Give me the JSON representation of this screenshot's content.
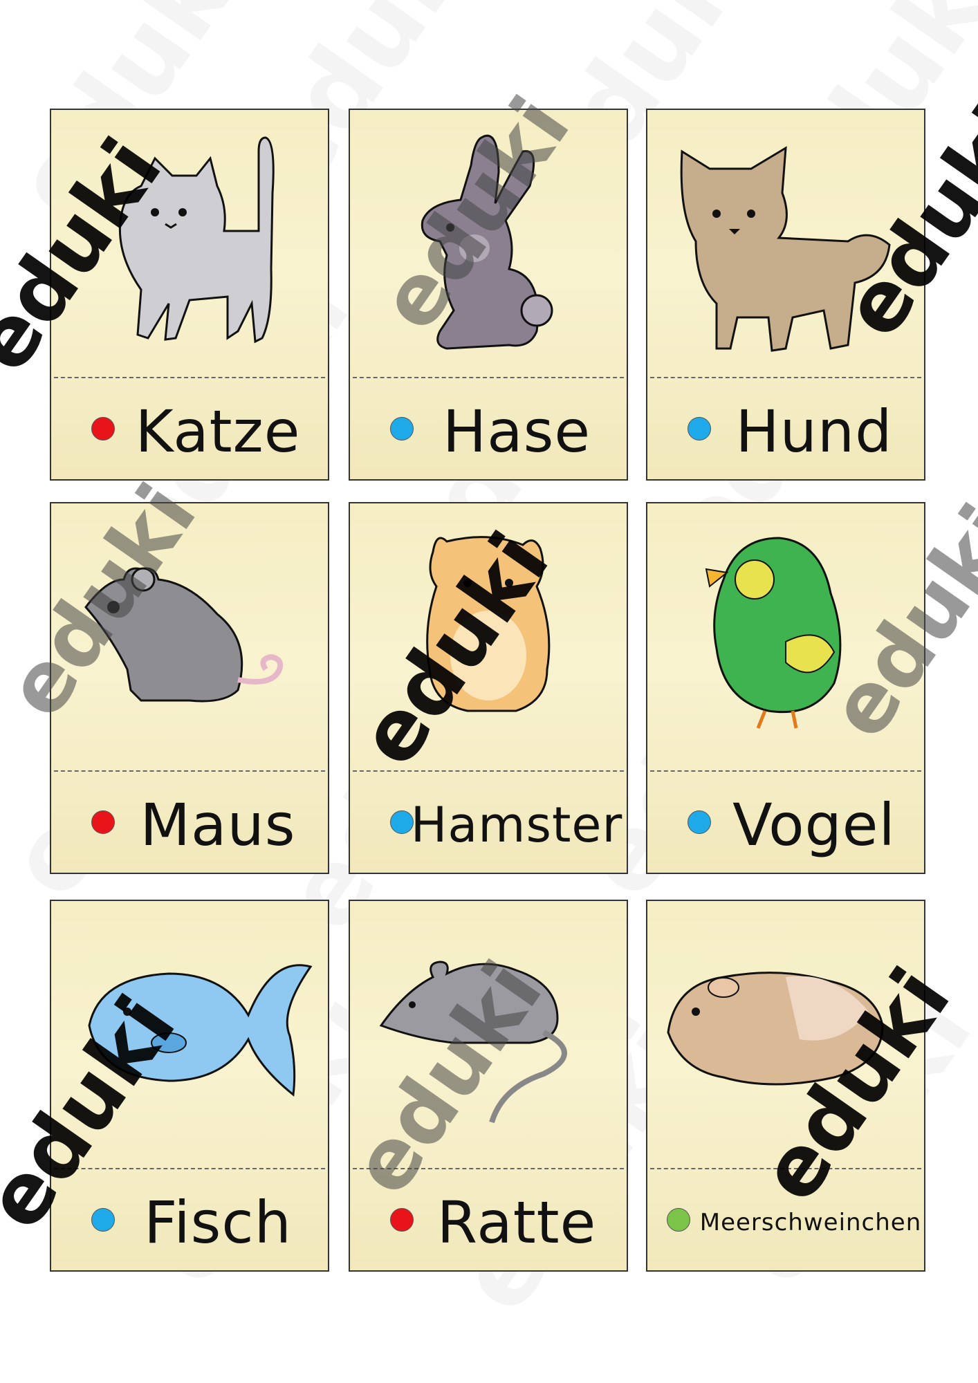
{
  "watermark": "eduki",
  "colors": {
    "red": "#e8141a",
    "blue": "#1ea9e8",
    "green": "#7cc34a"
  },
  "cards": [
    {
      "word": "Katze",
      "dot": "red",
      "icon": "cat-icon"
    },
    {
      "word": "Hase",
      "dot": "blue",
      "icon": "rabbit-icon"
    },
    {
      "word": "Hund",
      "dot": "blue",
      "icon": "dog-icon"
    },
    {
      "word": "Maus",
      "dot": "red",
      "icon": "mouse-icon"
    },
    {
      "word": "Hamster",
      "dot": "blue",
      "icon": "hamster-icon"
    },
    {
      "word": "Vogel",
      "dot": "blue",
      "icon": "bird-icon"
    },
    {
      "word": "Fisch",
      "dot": "blue",
      "icon": "fish-icon"
    },
    {
      "word": "Ratte",
      "dot": "red",
      "icon": "rat-icon"
    },
    {
      "word": "Meerschweinchen",
      "dot": "green",
      "icon": "guinea-pig-icon"
    }
  ]
}
